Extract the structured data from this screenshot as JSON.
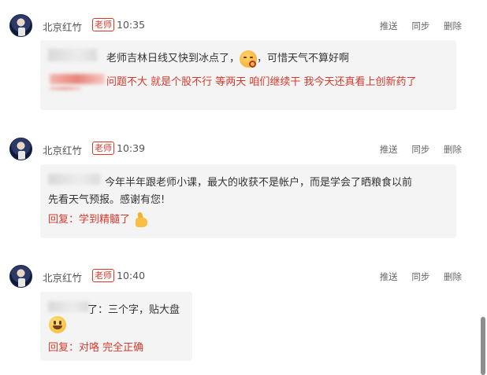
{
  "posts": [
    {
      "author": "北京红竹",
      "badge": "老师",
      "time": "10:35",
      "actions": [
        "推送",
        "同步",
        "删除"
      ],
      "comment": "老师吉林日线又快到冰点了，",
      "comment_after_emoji": "，可惜天气不算好啊",
      "emoji": "kiss-emoji",
      "reply": "问题不大 就是个股不行 等两天 咱们继续干 我今天还真看上创新药了"
    },
    {
      "author": "北京红竹",
      "badge": "老师",
      "time": "10:39",
      "actions": [
        "推送",
        "同步",
        "删除"
      ],
      "comment_line1": "今年半年跟老师小课，最大的收获不是帐户，而是学会了晒粮食以前",
      "comment_line2": "先看天气预报。感谢有您!",
      "reply": "回复：学到精髓了",
      "emoji": "thumbs-up-emoji"
    },
    {
      "author": "北京红竹",
      "badge": "老师",
      "time": "10:40",
      "actions": [
        "推送",
        "同步",
        "删除"
      ],
      "comment": "了：三个字，贴大盘",
      "emoji": "smile-emoji",
      "reply": "回复：对咯 完全正确"
    }
  ],
  "colors": {
    "accent": "#d33a2c",
    "bubble": "#f4f4f4",
    "meta": "#555555"
  }
}
